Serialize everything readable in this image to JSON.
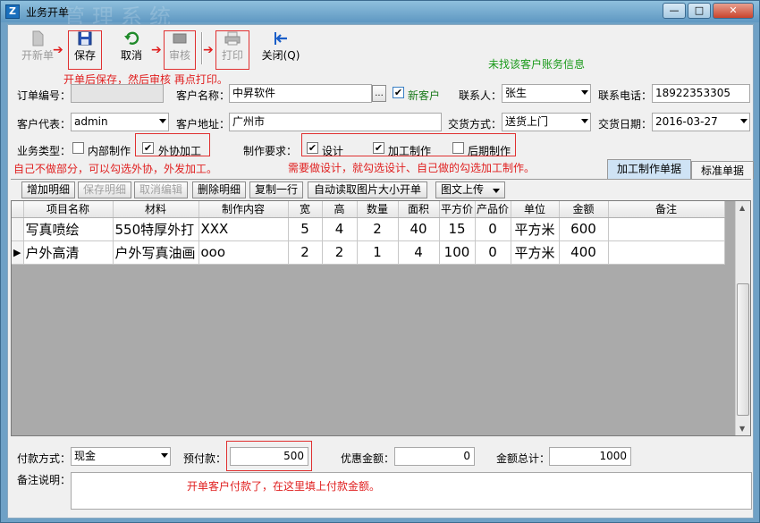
{
  "window": {
    "title": "业务开单",
    "decor": "管理系统",
    "btn_min": "—",
    "btn_max": "□",
    "btn_close": "✕"
  },
  "toolbar": {
    "new": "开新单",
    "save": "保存",
    "cancel": "取消",
    "audit": "审核",
    "print": "打印",
    "close": "关闭(Q)",
    "hint": "开单后保存，然后审核 再点打印。",
    "status": "未找该客户账务信息"
  },
  "form": {
    "order_no_label": "订单编号：",
    "order_no": "",
    "customer_label": "客户名称：",
    "customer": "中昇软件",
    "customer_browse": "...",
    "new_customer_label": "新客户",
    "new_customer_checked": true,
    "contact_label": "联系人：",
    "contact": "张生",
    "phone_label": "联系电话：",
    "phone": "18922353305",
    "rep_label": "客户代表：",
    "rep": "admin",
    "address_label": "客户地址：",
    "address": "广州市",
    "delivery_label": "交货方式：",
    "delivery": "送货上门",
    "date_label": "交货日期：",
    "date": "2016-03-27",
    "biz_type_label": "业务类型：",
    "internal_label": "内部制作",
    "internal_checked": false,
    "outsource_label": "外协加工",
    "outsource_checked": true,
    "req_label": "制作要求：",
    "design_label": "设计",
    "design_checked": true,
    "process_label": "加工制作",
    "process_checked": true,
    "post_label": "后期制作",
    "post_checked": false,
    "hint_outsource": "自己不做部分，可以勾选外协，外发加工。",
    "hint_design": "需要做设计，就勾选设计、自己做的勾选加工制作。"
  },
  "tabs": [
    {
      "label": "加工制作单据",
      "active": true
    },
    {
      "label": "标准单据",
      "active": false
    }
  ],
  "actions": {
    "add": "增加明细",
    "save": "保存明细",
    "cancel_edit": "取消编辑",
    "delete": "删除明细",
    "copy": "复制一行",
    "auto_read": "自动读取图片大小开单",
    "upload": "图文上传"
  },
  "table": {
    "columns": [
      "项目名称",
      "材料",
      "制作内容",
      "宽",
      "高",
      "数量",
      "面积",
      "平方价",
      "产品价",
      "单位",
      "金额",
      "备注"
    ],
    "rows": [
      [
        "写真喷绘",
        "550特厚外打",
        "XXX",
        "5",
        "4",
        "2",
        "40",
        "15",
        "0",
        "平方米",
        "600",
        ""
      ],
      [
        "户外高清",
        "户外写真油画",
        "ooo",
        "2",
        "2",
        "1",
        "4",
        "100",
        "0",
        "平方米",
        "400",
        ""
      ]
    ],
    "current_row_marker": "▶"
  },
  "footer": {
    "pay_method_label": "付款方式：",
    "pay_method": "现金",
    "prepay_label": "预付款：",
    "prepay": "500",
    "discount_label": "优惠金额：",
    "discount": "0",
    "total_label": "金额总计：",
    "total": "1000",
    "remark_label": "备注说明：",
    "hint_prepay": "开单客户付款了，在这里填上付款金额。"
  },
  "colors": {
    "accent_red": "#e02020",
    "status_green": "#1a9a1a",
    "tab_active": "#cfe3f5"
  }
}
